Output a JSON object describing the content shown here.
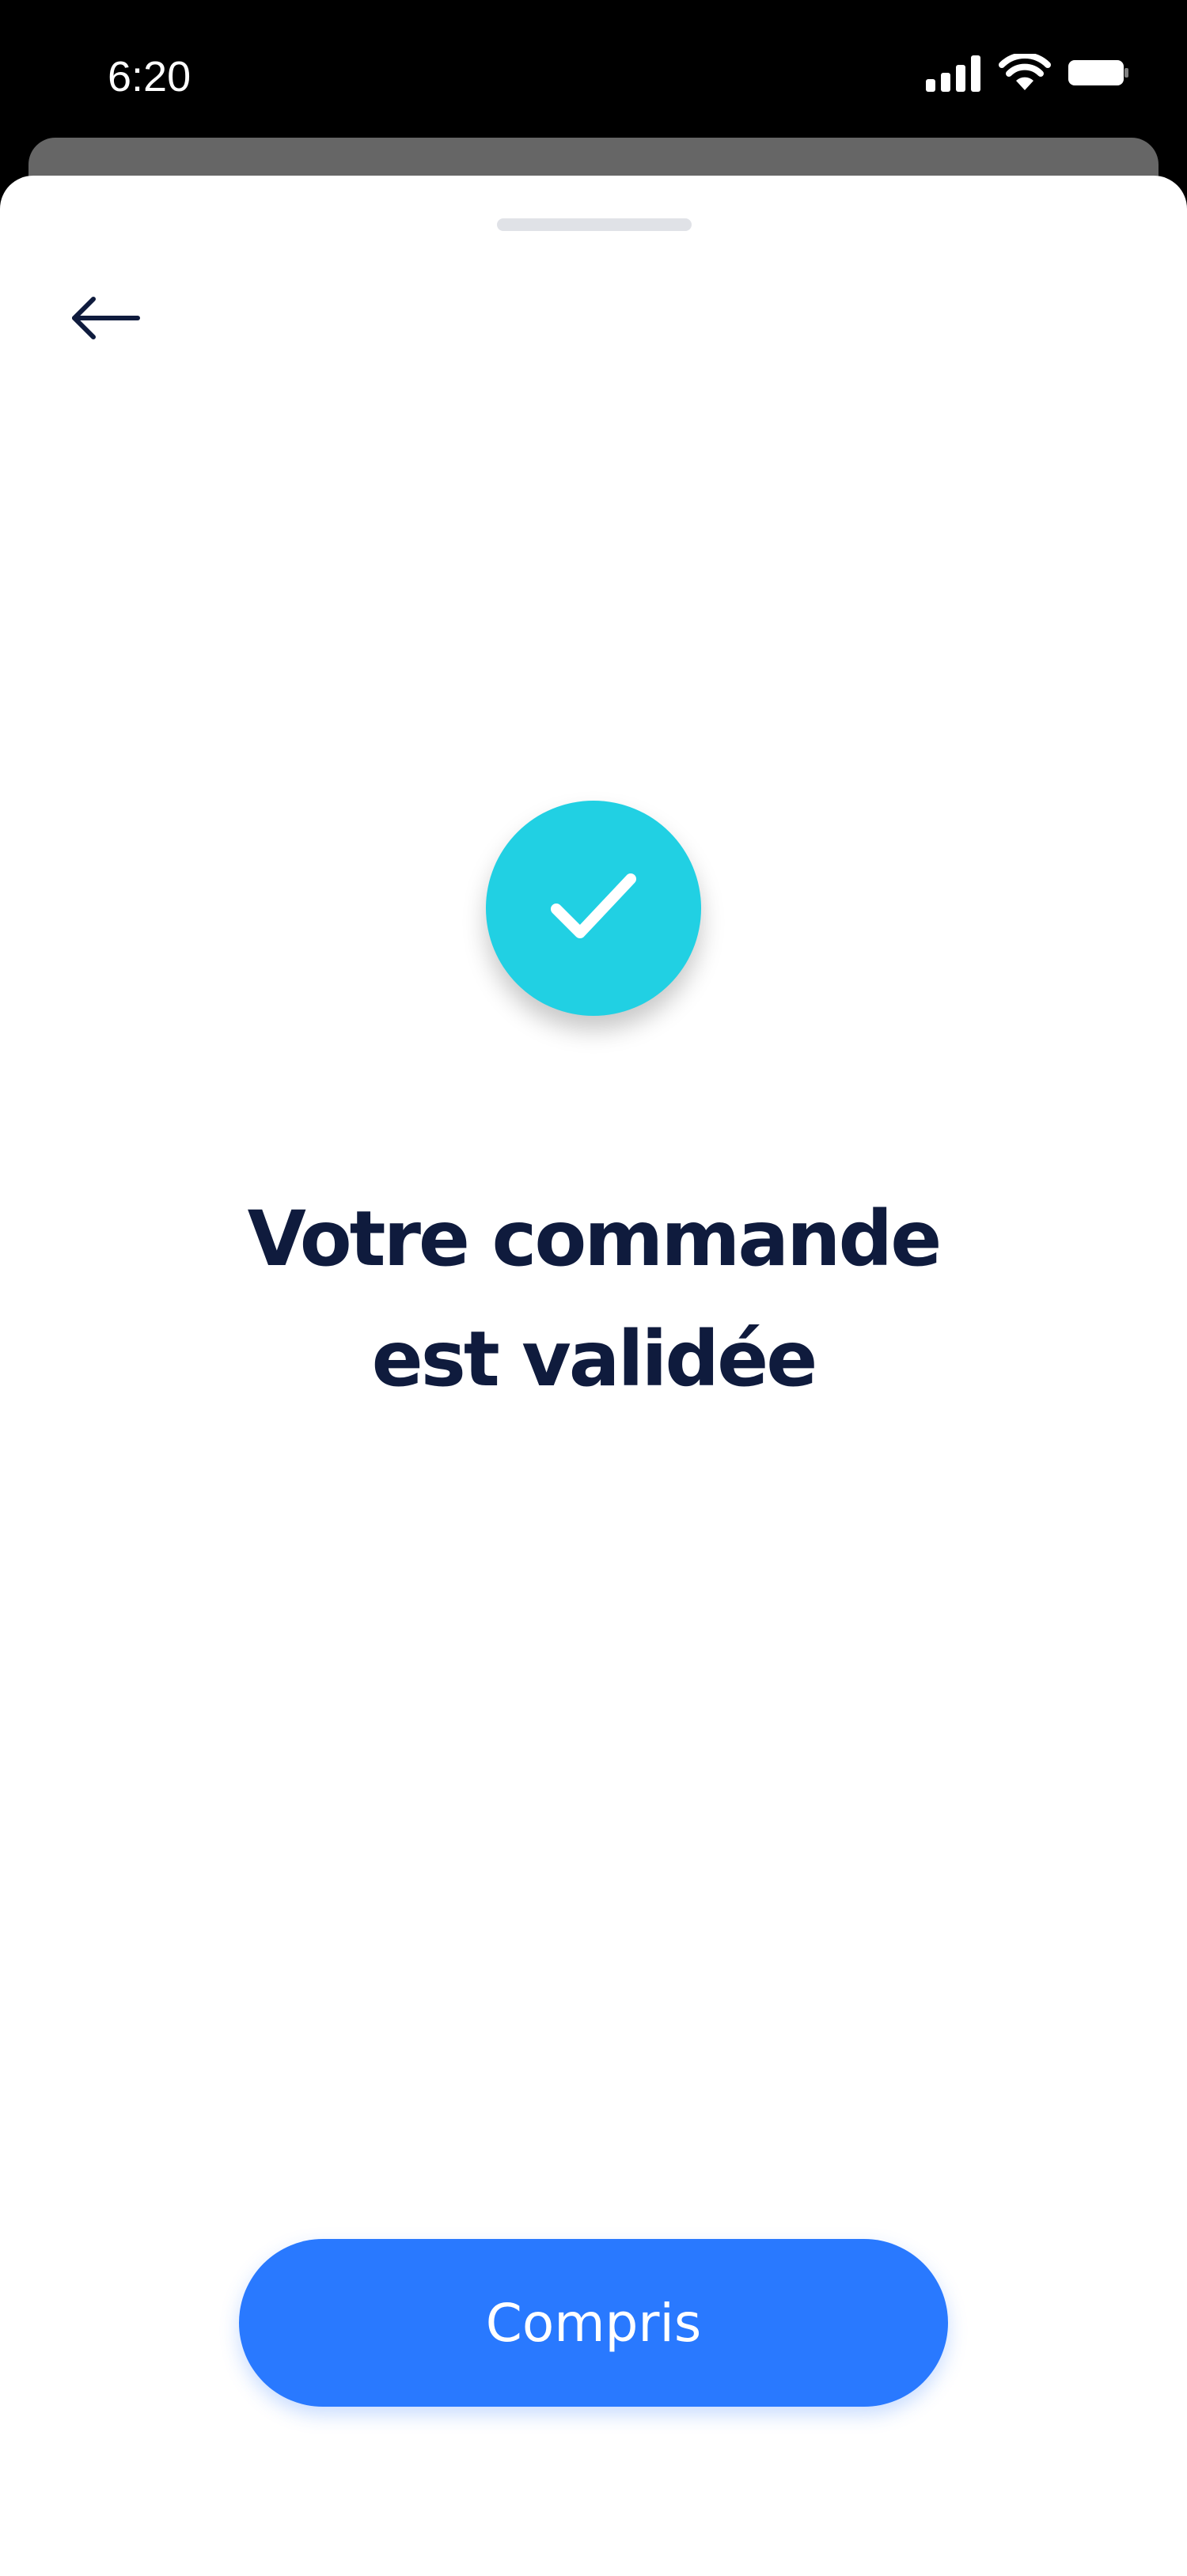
{
  "status_bar": {
    "time": "6:20",
    "icons": [
      "cellular-signal-icon",
      "wifi-icon",
      "battery-icon"
    ]
  },
  "header": {
    "back_icon": "arrow-left-icon"
  },
  "confirmation": {
    "icon": "checkmark-icon",
    "title_line1": "Votre commande",
    "title_line2": "est validée"
  },
  "actions": {
    "confirm_label": "Compris"
  },
  "colors": {
    "accent_button": "#2979ff",
    "success_badge": "#21d0e3",
    "title_text": "#0f1b3d"
  }
}
